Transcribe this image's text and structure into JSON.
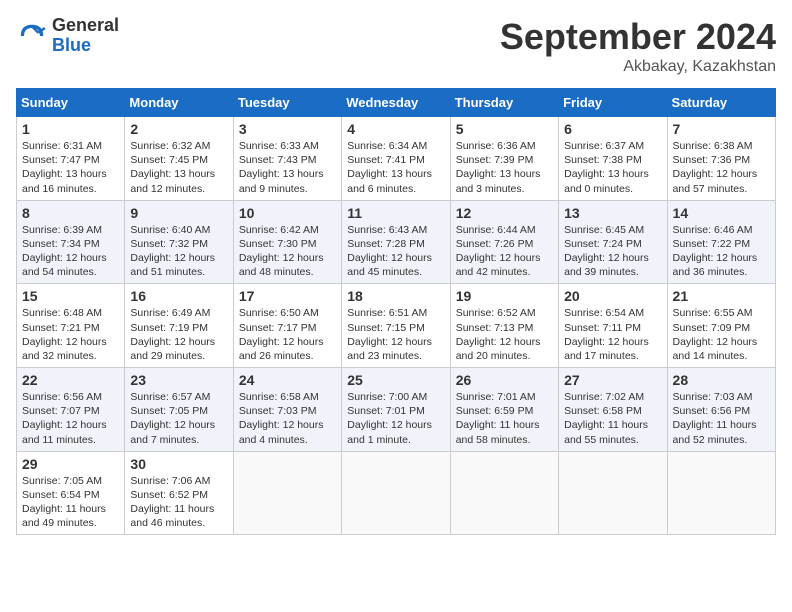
{
  "header": {
    "logo_general": "General",
    "logo_blue": "Blue",
    "month_title": "September 2024",
    "location": "Akbakay, Kazakhstan"
  },
  "weekdays": [
    "Sunday",
    "Monday",
    "Tuesday",
    "Wednesday",
    "Thursday",
    "Friday",
    "Saturday"
  ],
  "weeks": [
    [
      {
        "day": "1",
        "info": "Sunrise: 6:31 AM\nSunset: 7:47 PM\nDaylight: 13 hours\nand 16 minutes."
      },
      {
        "day": "2",
        "info": "Sunrise: 6:32 AM\nSunset: 7:45 PM\nDaylight: 13 hours\nand 12 minutes."
      },
      {
        "day": "3",
        "info": "Sunrise: 6:33 AM\nSunset: 7:43 PM\nDaylight: 13 hours\nand 9 minutes."
      },
      {
        "day": "4",
        "info": "Sunrise: 6:34 AM\nSunset: 7:41 PM\nDaylight: 13 hours\nand 6 minutes."
      },
      {
        "day": "5",
        "info": "Sunrise: 6:36 AM\nSunset: 7:39 PM\nDaylight: 13 hours\nand 3 minutes."
      },
      {
        "day": "6",
        "info": "Sunrise: 6:37 AM\nSunset: 7:38 PM\nDaylight: 13 hours\nand 0 minutes."
      },
      {
        "day": "7",
        "info": "Sunrise: 6:38 AM\nSunset: 7:36 PM\nDaylight: 12 hours\nand 57 minutes."
      }
    ],
    [
      {
        "day": "8",
        "info": "Sunrise: 6:39 AM\nSunset: 7:34 PM\nDaylight: 12 hours\nand 54 minutes."
      },
      {
        "day": "9",
        "info": "Sunrise: 6:40 AM\nSunset: 7:32 PM\nDaylight: 12 hours\nand 51 minutes."
      },
      {
        "day": "10",
        "info": "Sunrise: 6:42 AM\nSunset: 7:30 PM\nDaylight: 12 hours\nand 48 minutes."
      },
      {
        "day": "11",
        "info": "Sunrise: 6:43 AM\nSunset: 7:28 PM\nDaylight: 12 hours\nand 45 minutes."
      },
      {
        "day": "12",
        "info": "Sunrise: 6:44 AM\nSunset: 7:26 PM\nDaylight: 12 hours\nand 42 minutes."
      },
      {
        "day": "13",
        "info": "Sunrise: 6:45 AM\nSunset: 7:24 PM\nDaylight: 12 hours\nand 39 minutes."
      },
      {
        "day": "14",
        "info": "Sunrise: 6:46 AM\nSunset: 7:22 PM\nDaylight: 12 hours\nand 36 minutes."
      }
    ],
    [
      {
        "day": "15",
        "info": "Sunrise: 6:48 AM\nSunset: 7:21 PM\nDaylight: 12 hours\nand 32 minutes."
      },
      {
        "day": "16",
        "info": "Sunrise: 6:49 AM\nSunset: 7:19 PM\nDaylight: 12 hours\nand 29 minutes."
      },
      {
        "day": "17",
        "info": "Sunrise: 6:50 AM\nSunset: 7:17 PM\nDaylight: 12 hours\nand 26 minutes."
      },
      {
        "day": "18",
        "info": "Sunrise: 6:51 AM\nSunset: 7:15 PM\nDaylight: 12 hours\nand 23 minutes."
      },
      {
        "day": "19",
        "info": "Sunrise: 6:52 AM\nSunset: 7:13 PM\nDaylight: 12 hours\nand 20 minutes."
      },
      {
        "day": "20",
        "info": "Sunrise: 6:54 AM\nSunset: 7:11 PM\nDaylight: 12 hours\nand 17 minutes."
      },
      {
        "day": "21",
        "info": "Sunrise: 6:55 AM\nSunset: 7:09 PM\nDaylight: 12 hours\nand 14 minutes."
      }
    ],
    [
      {
        "day": "22",
        "info": "Sunrise: 6:56 AM\nSunset: 7:07 PM\nDaylight: 12 hours\nand 11 minutes."
      },
      {
        "day": "23",
        "info": "Sunrise: 6:57 AM\nSunset: 7:05 PM\nDaylight: 12 hours\nand 7 minutes."
      },
      {
        "day": "24",
        "info": "Sunrise: 6:58 AM\nSunset: 7:03 PM\nDaylight: 12 hours\nand 4 minutes."
      },
      {
        "day": "25",
        "info": "Sunrise: 7:00 AM\nSunset: 7:01 PM\nDaylight: 12 hours\nand 1 minute."
      },
      {
        "day": "26",
        "info": "Sunrise: 7:01 AM\nSunset: 6:59 PM\nDaylight: 11 hours\nand 58 minutes."
      },
      {
        "day": "27",
        "info": "Sunrise: 7:02 AM\nSunset: 6:58 PM\nDaylight: 11 hours\nand 55 minutes."
      },
      {
        "day": "28",
        "info": "Sunrise: 7:03 AM\nSunset: 6:56 PM\nDaylight: 11 hours\nand 52 minutes."
      }
    ],
    [
      {
        "day": "29",
        "info": "Sunrise: 7:05 AM\nSunset: 6:54 PM\nDaylight: 11 hours\nand 49 minutes."
      },
      {
        "day": "30",
        "info": "Sunrise: 7:06 AM\nSunset: 6:52 PM\nDaylight: 11 hours\nand 46 minutes."
      },
      {
        "day": "",
        "info": ""
      },
      {
        "day": "",
        "info": ""
      },
      {
        "day": "",
        "info": ""
      },
      {
        "day": "",
        "info": ""
      },
      {
        "day": "",
        "info": ""
      }
    ]
  ]
}
